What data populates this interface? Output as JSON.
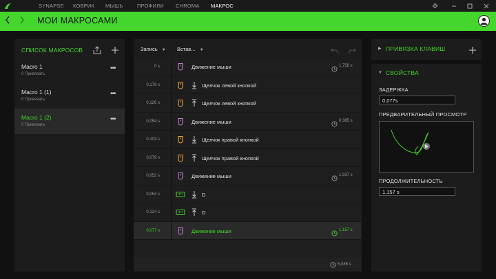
{
  "nav": {
    "tabs": [
      "SYNAPSE",
      "КОВРИК",
      "МЫШЬ",
      "ПРОФИЛИ",
      "CHROMA",
      "МАКРОС"
    ],
    "active_tab": "МАКРОС"
  },
  "header": {
    "title": "МОИ МАКРОСАМИ"
  },
  "macro_list": {
    "title": "СПИСОК МАКРОСОВ",
    "items": [
      {
        "name": "Macro 1",
        "sub": "0 Привязать"
      },
      {
        "name": "Macro 1 (1)",
        "sub": "0 Привязать"
      },
      {
        "name": "Macro 1 (2)",
        "sub": "0 Привязать"
      }
    ]
  },
  "editor": {
    "record_label": "Запись",
    "insert_label": "Встав...",
    "rows": [
      {
        "delay": "0 s",
        "icon": "mouse-icon",
        "arrow": "",
        "label": "Движение мыши",
        "duration": "1,758 s"
      },
      {
        "delay": "0,179 s",
        "icon": "mouse-icon",
        "arrow": "down",
        "label": "Щелчок левой кнопкой",
        "duration": ""
      },
      {
        "delay": "0,126 s",
        "icon": "mouse-icon",
        "arrow": "up",
        "label": "Щелчок левой кнопкой",
        "duration": ""
      },
      {
        "delay": "0,054 s",
        "icon": "mouse-icon",
        "arrow": "",
        "label": "Движение мыши",
        "duration": "0,385 s"
      },
      {
        "delay": "0,103 s",
        "icon": "mouse-icon",
        "arrow": "down",
        "label": "Щелчок правой кнопкой",
        "duration": ""
      },
      {
        "delay": "0,079 s",
        "icon": "mouse-icon",
        "arrow": "up",
        "label": "Щелчок правой кнопкой",
        "duration": ""
      },
      {
        "delay": "0,052 s",
        "icon": "mouse-icon",
        "arrow": "",
        "label": "Движение мыши",
        "duration": "1,937 s"
      },
      {
        "delay": "0,054 s",
        "icon": "keyboard-icon",
        "arrow": "down",
        "label": "D",
        "duration": ""
      },
      {
        "delay": "0,124 s",
        "icon": "keyboard-icon",
        "arrow": "up",
        "label": "D",
        "duration": ""
      },
      {
        "delay": "0,077 s",
        "icon": "mouse-icon",
        "arrow": "",
        "label": "Движение мыши",
        "duration": "1,157 s"
      }
    ],
    "total": "6,085 s"
  },
  "keybind": {
    "title": "ПРИВЯЗКА КЛАВИШ"
  },
  "properties": {
    "title": "СВОЙСТВА",
    "delay_label": "ЗАДЕРЖКА",
    "delay_value": "0,077s",
    "preview_label": "ПРЕДВАРИТЕЛЬНЫЙ ПРОСМОТР",
    "duration_label": "ПРОДОЛЖИТЕЛЬНОСТЬ",
    "duration_value": "1,157 s"
  },
  "colors": {
    "accent": "#44d62c",
    "mouse_icon": "#c77bd8",
    "mouse_icon_orange": "#f0a030",
    "keyboard_icon": "#44d62c"
  }
}
